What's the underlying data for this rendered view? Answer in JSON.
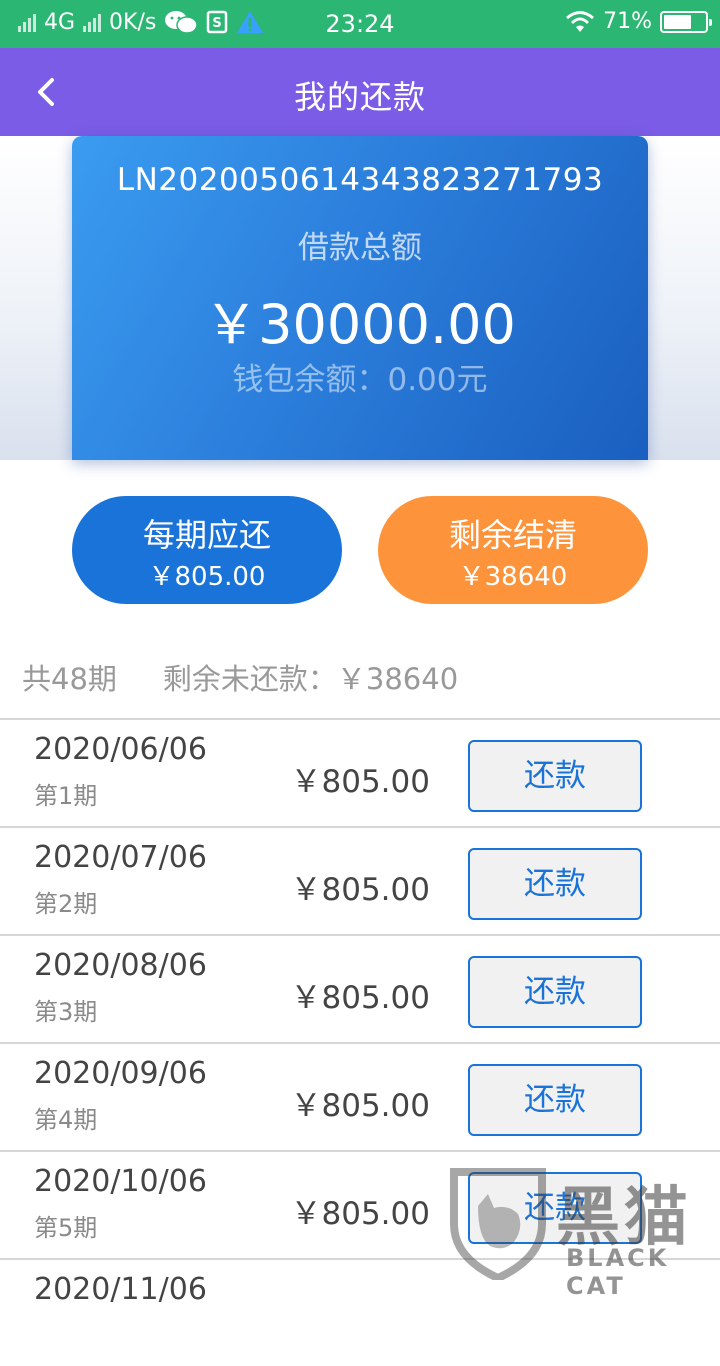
{
  "status_bar": {
    "network": "4G",
    "speed": "0K/s",
    "time": "23:24",
    "battery": "71%",
    "battery_level": 0.71,
    "icons": [
      "signal-icon",
      "wechat-icon",
      "sim-icon",
      "warning-icon",
      "wifi-icon",
      "battery-icon"
    ]
  },
  "header": {
    "title": "我的还款",
    "back_icon": "chevron-left-icon"
  },
  "loan_card": {
    "loan_no": "LN20200506143438232717​93",
    "total_label": "借款总额",
    "total_amount": "￥30000.00",
    "wallet_balance": "钱包余额：0.00元"
  },
  "actions": {
    "per_period": {
      "title": "每期应还",
      "amount": "￥805.00"
    },
    "payoff": {
      "title": "剩余结清",
      "amount": "￥38640"
    }
  },
  "summary": {
    "periods": "共48期",
    "remaining": "剩余未还款：￥38640"
  },
  "installments": [
    {
      "date": "2020/06/06",
      "period": "第1期",
      "amount": "￥805.00",
      "button": "还款"
    },
    {
      "date": "2020/07/06",
      "period": "第2期",
      "amount": "￥805.00",
      "button": "还款"
    },
    {
      "date": "2020/08/06",
      "period": "第3期",
      "amount": "￥805.00",
      "button": "还款"
    },
    {
      "date": "2020/09/06",
      "period": "第4期",
      "amount": "￥805.00",
      "button": "还款"
    },
    {
      "date": "2020/10/06",
      "period": "第5期",
      "amount": "￥805.00",
      "button": "还款"
    },
    {
      "date": "2020/11/06",
      "period": "",
      "amount": "",
      "button": ""
    }
  ],
  "watermark": {
    "text": "黑猫",
    "subtext": "BLACK CAT"
  },
  "colors": {
    "status_bar": "#2bb673",
    "nav_bar": "#7b5ce6",
    "card": "#2c7fdc",
    "primary": "#1a73d8",
    "orange": "#fd943b"
  }
}
